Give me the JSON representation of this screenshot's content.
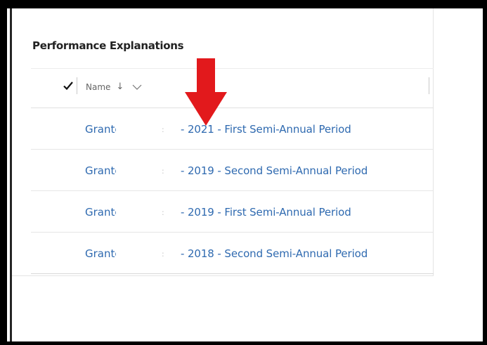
{
  "panel": {
    "title": "Performance Explanations"
  },
  "table": {
    "column_header": "Name",
    "sort_glyph": "↓",
    "rows": [
      {
        "prefix": "Grante",
        "suffix": "- 2021 - First Semi-Annual Period"
      },
      {
        "prefix": "Grante",
        "suffix": "- 2019 - Second Semi-Annual Period"
      },
      {
        "prefix": "Grante",
        "suffix": "- 2019 - First Semi-Annual Period"
      },
      {
        "prefix": "Grante",
        "suffix": "- 2018 - Second Semi-Annual Period"
      }
    ]
  },
  "colors": {
    "link": "#2f6ab0",
    "annotation_arrow": "#e2191c",
    "frame": "#000000"
  },
  "icons": {
    "select_all": "checkmark-icon",
    "sort": "arrow-down-icon",
    "column_menu": "chevron-down-icon",
    "annotation": "red-arrow-annotation"
  }
}
